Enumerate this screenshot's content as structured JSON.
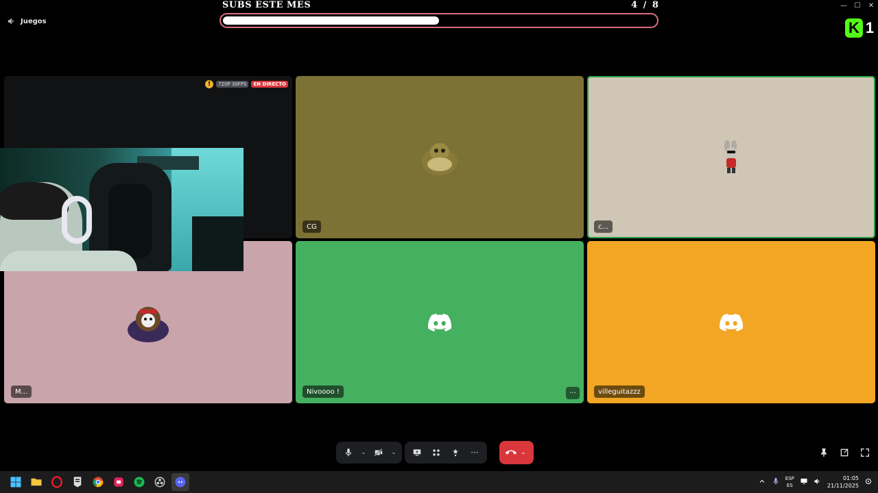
{
  "window": {
    "controls": [
      "—",
      "☐",
      "✕"
    ]
  },
  "channel": {
    "name": "Juegos"
  },
  "subs_overlay": {
    "title": "SUBS ESTE MES",
    "current": "4",
    "goal": "/ 8",
    "progress": 0.5
  },
  "logo": {
    "k": "K",
    "num": "1",
    "color": "#53fc18"
  },
  "stream_tile": {
    "quality": "720P 30FPS",
    "live": "EN DIRECTO",
    "warning": "!"
  },
  "tiles": [
    {
      "name": "CG",
      "bg": "#7d7235"
    },
    {
      "name": "c...",
      "bg": "#cfc6b5"
    },
    {
      "name": "M...",
      "bg": "#c9a4ab"
    },
    {
      "name": "Nivoooo !",
      "bg": "#45b060"
    },
    {
      "name": "villeguitazzz",
      "bg": "#f2a623"
    }
  ],
  "tile_more": "···",
  "toolbar": {
    "mic_icon": "microphone-icon",
    "camera_icon": "camera-off-icon",
    "screen_icon": "screen-share-icon",
    "activity_icon": "activity-icon",
    "soundboard_icon": "soundboard-icon",
    "more": "···",
    "hangup_icon": "phone-hangup-icon",
    "chevron": "⌄"
  },
  "taskbar": {
    "language_top": "ESP",
    "language_bottom": "ES",
    "time": "01:05",
    "date": "21/11/2025"
  }
}
